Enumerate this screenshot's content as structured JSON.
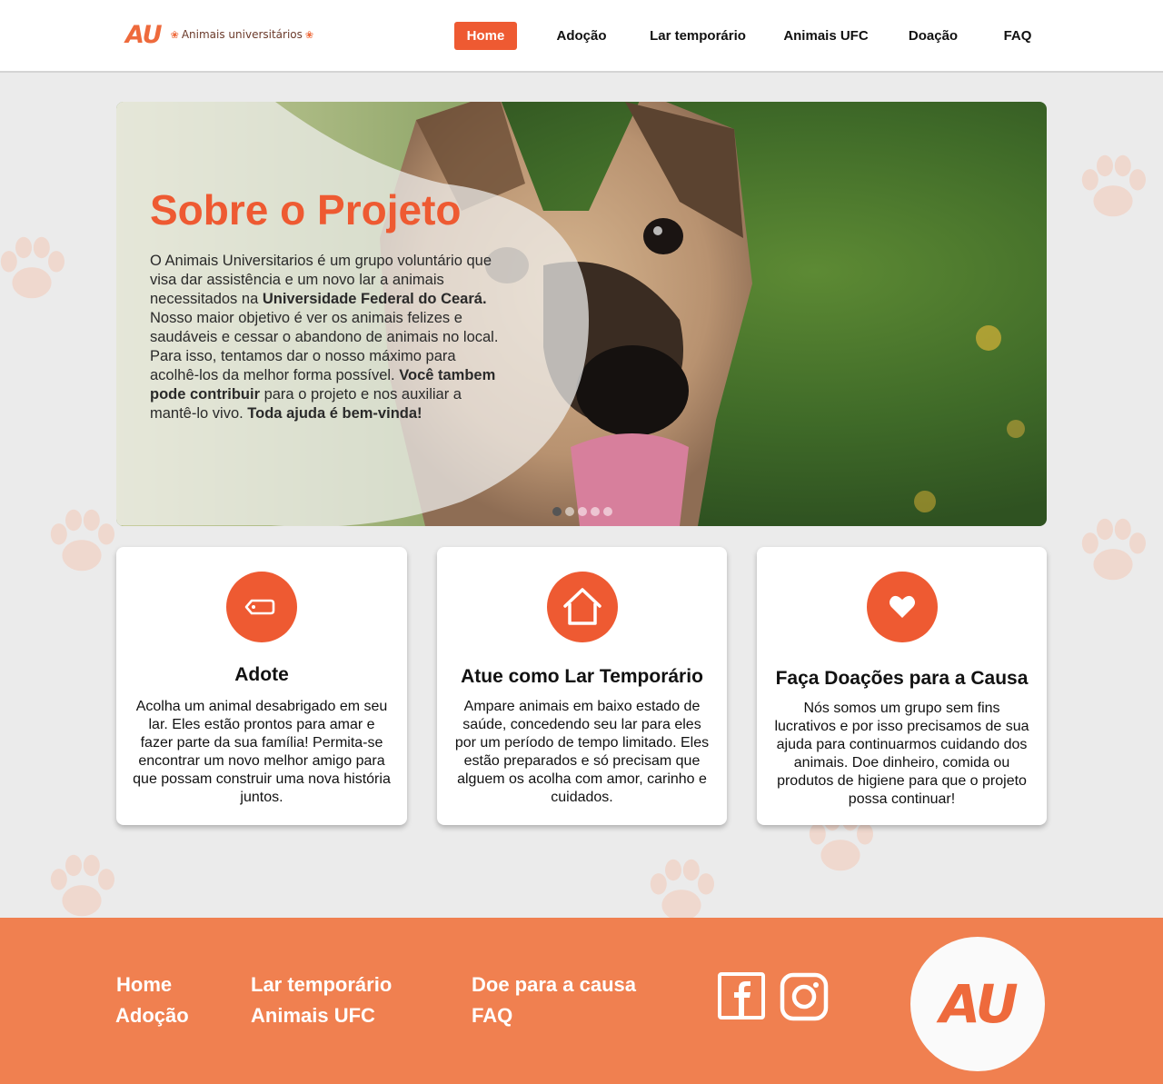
{
  "brand": {
    "logo_mark": "AU",
    "logo_name": "Animais universitários",
    "accent_color": "#ee5a32",
    "footer_color": "#f08050"
  },
  "nav": {
    "items": [
      {
        "label": "Home",
        "active": true
      },
      {
        "label": "Adoção",
        "active": false
      },
      {
        "label": "Lar temporário",
        "active": false
      },
      {
        "label": "Animais UFC",
        "active": false
      },
      {
        "label": "Doação",
        "active": false
      },
      {
        "label": "FAQ",
        "active": false
      }
    ]
  },
  "hero": {
    "title": "Sobre o Projeto",
    "text_1": "O Animais Universitarios é um grupo voluntário que visa dar assistência e um novo lar a animais necessitados na ",
    "text_bold_1": "Universidade Federal do Ceará.",
    "text_2": " Nosso maior objetivo é ver os animais felizes e saudáveis e cessar o abandono de animais no local. Para isso, tentamos dar o nosso máximo para acolhê-los da melhor forma possível. ",
    "text_bold_2": "Você tambem pode contribuir",
    "text_3": " para o projeto e nos auxiliar a mantê-lo vivo. ",
    "text_bold_3": "Toda ajuda é bem-vinda!",
    "slide_count": 5,
    "active_slide": 1
  },
  "cards": [
    {
      "icon": "tag-icon",
      "title": "Adote",
      "text": "Acolha um animal desabrigado em seu lar. Eles estão prontos para amar e fazer parte da sua família! Permita-se encontrar um novo melhor amigo para que possam construir uma nova história juntos."
    },
    {
      "icon": "house-icon",
      "title": "Atue como Lar Temporário",
      "text": "Ampare animais em baixo estado de saúde, concedendo seu lar para eles por um período de tempo limitado. Eles estão preparados e só precisam que alguem os acolha com amor, carinho e cuidados."
    },
    {
      "icon": "heart-icon",
      "title": "Faça Doações para a Causa",
      "text": "Nós somos um grupo sem fins lucrativos e por isso precisamos de sua ajuda para continuarmos cuidando dos animais. Doe dinheiro, comida ou produtos de higiene para que o projeto possa continuar!"
    }
  ],
  "footer": {
    "links": [
      "Home",
      "Adoção",
      "Lar temporário",
      "Animais UFC",
      "Doe para a causa",
      "FAQ"
    ],
    "social": [
      "facebook-icon",
      "instagram-icon"
    ],
    "logo_mark": "AU"
  }
}
